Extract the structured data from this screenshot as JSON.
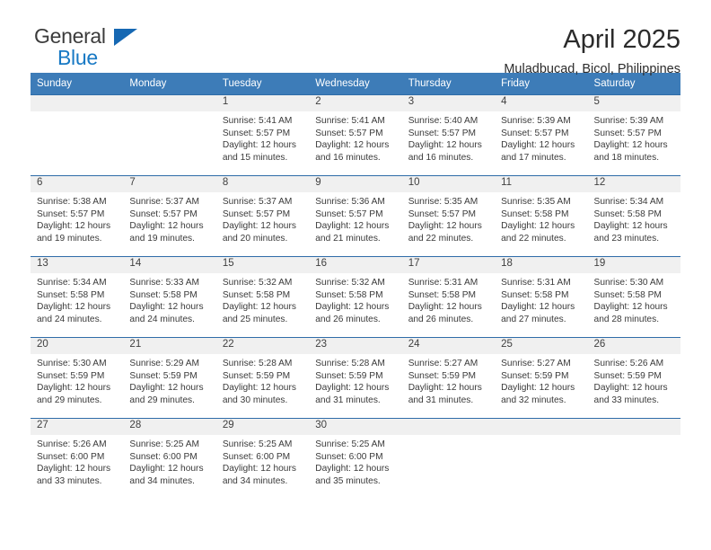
{
  "brand": {
    "name_top": "General",
    "name_bottom": "Blue",
    "triangle_color": "#1668b3",
    "blue_color": "#1879c4"
  },
  "header": {
    "title": "April 2025",
    "subtitle": "Muladbucad, Bicol, Philippines"
  },
  "theme": {
    "header_bg": "#3d7cb8",
    "row_divider": "#2f6ca8",
    "daynum_band": "#f0f0f0"
  },
  "weekday_headers": [
    "Sunday",
    "Monday",
    "Tuesday",
    "Wednesday",
    "Thursday",
    "Friday",
    "Saturday"
  ],
  "weeks": [
    [
      {
        "day": "",
        "sunrise": "",
        "sunset": "",
        "daylight": "",
        "daylight2": ""
      },
      {
        "day": "",
        "sunrise": "",
        "sunset": "",
        "daylight": "",
        "daylight2": ""
      },
      {
        "day": "1",
        "sunrise": "Sunrise: 5:41 AM",
        "sunset": "Sunset: 5:57 PM",
        "daylight": "Daylight: 12 hours",
        "daylight2": "and 15 minutes."
      },
      {
        "day": "2",
        "sunrise": "Sunrise: 5:41 AM",
        "sunset": "Sunset: 5:57 PM",
        "daylight": "Daylight: 12 hours",
        "daylight2": "and 16 minutes."
      },
      {
        "day": "3",
        "sunrise": "Sunrise: 5:40 AM",
        "sunset": "Sunset: 5:57 PM",
        "daylight": "Daylight: 12 hours",
        "daylight2": "and 16 minutes."
      },
      {
        "day": "4",
        "sunrise": "Sunrise: 5:39 AM",
        "sunset": "Sunset: 5:57 PM",
        "daylight": "Daylight: 12 hours",
        "daylight2": "and 17 minutes."
      },
      {
        "day": "5",
        "sunrise": "Sunrise: 5:39 AM",
        "sunset": "Sunset: 5:57 PM",
        "daylight": "Daylight: 12 hours",
        "daylight2": "and 18 minutes."
      }
    ],
    [
      {
        "day": "6",
        "sunrise": "Sunrise: 5:38 AM",
        "sunset": "Sunset: 5:57 PM",
        "daylight": "Daylight: 12 hours",
        "daylight2": "and 19 minutes."
      },
      {
        "day": "7",
        "sunrise": "Sunrise: 5:37 AM",
        "sunset": "Sunset: 5:57 PM",
        "daylight": "Daylight: 12 hours",
        "daylight2": "and 19 minutes."
      },
      {
        "day": "8",
        "sunrise": "Sunrise: 5:37 AM",
        "sunset": "Sunset: 5:57 PM",
        "daylight": "Daylight: 12 hours",
        "daylight2": "and 20 minutes."
      },
      {
        "day": "9",
        "sunrise": "Sunrise: 5:36 AM",
        "sunset": "Sunset: 5:57 PM",
        "daylight": "Daylight: 12 hours",
        "daylight2": "and 21 minutes."
      },
      {
        "day": "10",
        "sunrise": "Sunrise: 5:35 AM",
        "sunset": "Sunset: 5:57 PM",
        "daylight": "Daylight: 12 hours",
        "daylight2": "and 22 minutes."
      },
      {
        "day": "11",
        "sunrise": "Sunrise: 5:35 AM",
        "sunset": "Sunset: 5:58 PM",
        "daylight": "Daylight: 12 hours",
        "daylight2": "and 22 minutes."
      },
      {
        "day": "12",
        "sunrise": "Sunrise: 5:34 AM",
        "sunset": "Sunset: 5:58 PM",
        "daylight": "Daylight: 12 hours",
        "daylight2": "and 23 minutes."
      }
    ],
    [
      {
        "day": "13",
        "sunrise": "Sunrise: 5:34 AM",
        "sunset": "Sunset: 5:58 PM",
        "daylight": "Daylight: 12 hours",
        "daylight2": "and 24 minutes."
      },
      {
        "day": "14",
        "sunrise": "Sunrise: 5:33 AM",
        "sunset": "Sunset: 5:58 PM",
        "daylight": "Daylight: 12 hours",
        "daylight2": "and 24 minutes."
      },
      {
        "day": "15",
        "sunrise": "Sunrise: 5:32 AM",
        "sunset": "Sunset: 5:58 PM",
        "daylight": "Daylight: 12 hours",
        "daylight2": "and 25 minutes."
      },
      {
        "day": "16",
        "sunrise": "Sunrise: 5:32 AM",
        "sunset": "Sunset: 5:58 PM",
        "daylight": "Daylight: 12 hours",
        "daylight2": "and 26 minutes."
      },
      {
        "day": "17",
        "sunrise": "Sunrise: 5:31 AM",
        "sunset": "Sunset: 5:58 PM",
        "daylight": "Daylight: 12 hours",
        "daylight2": "and 26 minutes."
      },
      {
        "day": "18",
        "sunrise": "Sunrise: 5:31 AM",
        "sunset": "Sunset: 5:58 PM",
        "daylight": "Daylight: 12 hours",
        "daylight2": "and 27 minutes."
      },
      {
        "day": "19",
        "sunrise": "Sunrise: 5:30 AM",
        "sunset": "Sunset: 5:58 PM",
        "daylight": "Daylight: 12 hours",
        "daylight2": "and 28 minutes."
      }
    ],
    [
      {
        "day": "20",
        "sunrise": "Sunrise: 5:30 AM",
        "sunset": "Sunset: 5:59 PM",
        "daylight": "Daylight: 12 hours",
        "daylight2": "and 29 minutes."
      },
      {
        "day": "21",
        "sunrise": "Sunrise: 5:29 AM",
        "sunset": "Sunset: 5:59 PM",
        "daylight": "Daylight: 12 hours",
        "daylight2": "and 29 minutes."
      },
      {
        "day": "22",
        "sunrise": "Sunrise: 5:28 AM",
        "sunset": "Sunset: 5:59 PM",
        "daylight": "Daylight: 12 hours",
        "daylight2": "and 30 minutes."
      },
      {
        "day": "23",
        "sunrise": "Sunrise: 5:28 AM",
        "sunset": "Sunset: 5:59 PM",
        "daylight": "Daylight: 12 hours",
        "daylight2": "and 31 minutes."
      },
      {
        "day": "24",
        "sunrise": "Sunrise: 5:27 AM",
        "sunset": "Sunset: 5:59 PM",
        "daylight": "Daylight: 12 hours",
        "daylight2": "and 31 minutes."
      },
      {
        "day": "25",
        "sunrise": "Sunrise: 5:27 AM",
        "sunset": "Sunset: 5:59 PM",
        "daylight": "Daylight: 12 hours",
        "daylight2": "and 32 minutes."
      },
      {
        "day": "26",
        "sunrise": "Sunrise: 5:26 AM",
        "sunset": "Sunset: 5:59 PM",
        "daylight": "Daylight: 12 hours",
        "daylight2": "and 33 minutes."
      }
    ],
    [
      {
        "day": "27",
        "sunrise": "Sunrise: 5:26 AM",
        "sunset": "Sunset: 6:00 PM",
        "daylight": "Daylight: 12 hours",
        "daylight2": "and 33 minutes."
      },
      {
        "day": "28",
        "sunrise": "Sunrise: 5:25 AM",
        "sunset": "Sunset: 6:00 PM",
        "daylight": "Daylight: 12 hours",
        "daylight2": "and 34 minutes."
      },
      {
        "day": "29",
        "sunrise": "Sunrise: 5:25 AM",
        "sunset": "Sunset: 6:00 PM",
        "daylight": "Daylight: 12 hours",
        "daylight2": "and 34 minutes."
      },
      {
        "day": "30",
        "sunrise": "Sunrise: 5:25 AM",
        "sunset": "Sunset: 6:00 PM",
        "daylight": "Daylight: 12 hours",
        "daylight2": "and 35 minutes."
      },
      {
        "day": "",
        "sunrise": "",
        "sunset": "",
        "daylight": "",
        "daylight2": ""
      },
      {
        "day": "",
        "sunrise": "",
        "sunset": "",
        "daylight": "",
        "daylight2": ""
      },
      {
        "day": "",
        "sunrise": "",
        "sunset": "",
        "daylight": "",
        "daylight2": ""
      }
    ]
  ]
}
